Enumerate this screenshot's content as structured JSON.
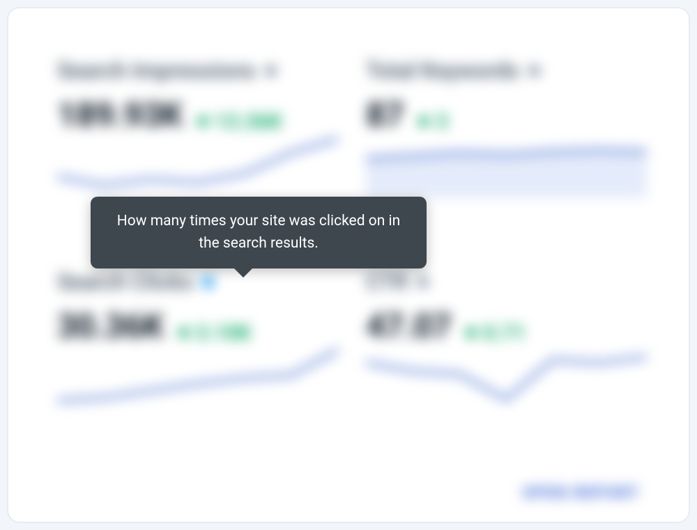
{
  "tooltip": {
    "text": "How many times your site was clicked on in the search results."
  },
  "footer": {
    "open_report": "OPEN REPORT"
  },
  "metrics": {
    "impressions": {
      "label": "Search Impressions",
      "value": "189.93K",
      "delta": "13.36K"
    },
    "keywords": {
      "label": "Total Keywords",
      "value": "87",
      "delta": "3"
    },
    "clicks": {
      "label": "Search Clicks",
      "value": "30.36K",
      "delta": "3.10K"
    },
    "ctr": {
      "label": "CTR",
      "value": "47.07",
      "delta": "0.71"
    }
  },
  "chart_data": [
    {
      "type": "line",
      "title": "Search Impressions",
      "x": [
        0,
        1,
        2,
        3,
        4,
        5,
        6
      ],
      "values": [
        42,
        36,
        40,
        38,
        44,
        62,
        78
      ],
      "ylim": [
        30,
        80
      ]
    },
    {
      "type": "area",
      "title": "Total Keywords",
      "x": [
        0,
        1,
        2,
        3,
        4,
        5,
        6
      ],
      "values": [
        80,
        82,
        84,
        83,
        85,
        86,
        85
      ],
      "ylim": [
        70,
        90
      ]
    },
    {
      "type": "line",
      "title": "Search Clicks",
      "x": [
        0,
        1,
        2,
        3,
        4,
        5,
        6
      ],
      "values": [
        30,
        32,
        36,
        40,
        44,
        46,
        70
      ],
      "ylim": [
        25,
        75
      ]
    },
    {
      "type": "line",
      "title": "CTR",
      "x": [
        0,
        1,
        2,
        3,
        4,
        5,
        6
      ],
      "values": [
        56,
        50,
        48,
        30,
        58,
        56,
        60
      ],
      "ylim": [
        25,
        65
      ]
    }
  ]
}
